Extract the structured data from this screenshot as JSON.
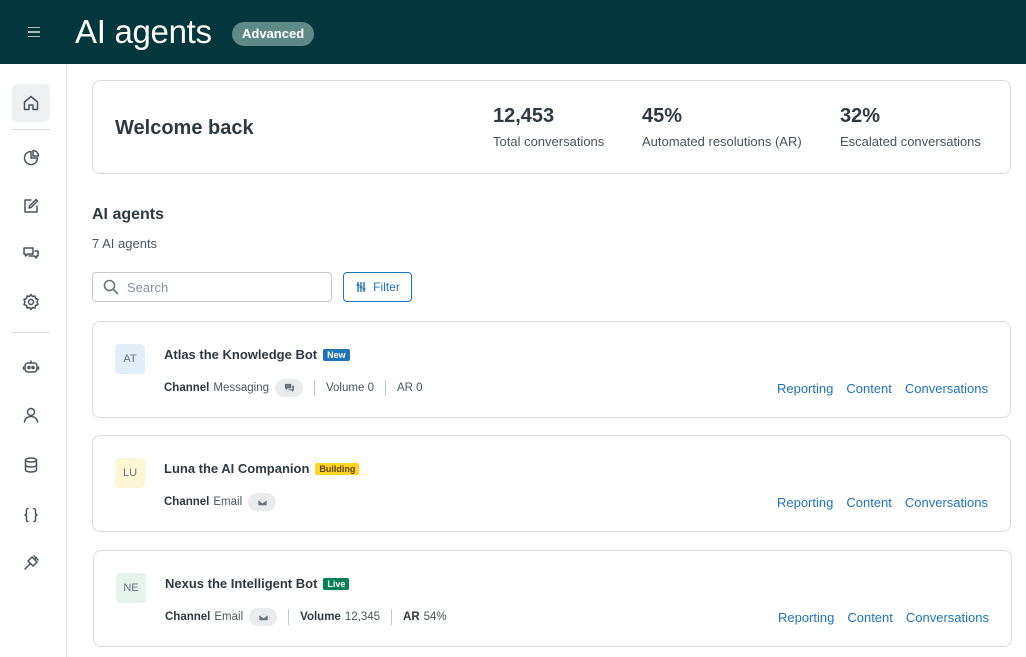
{
  "header": {
    "title": "AI agents",
    "plan_badge": "Advanced"
  },
  "sidebar": {
    "items": [
      {
        "name": "home-icon",
        "active": true
      },
      {
        "name": "analytics-icon"
      },
      {
        "name": "edit-icon"
      },
      {
        "name": "conversations-icon"
      },
      {
        "name": "settings-icon"
      },
      {
        "name": "bot-icon"
      },
      {
        "name": "user-icon"
      },
      {
        "name": "database-icon"
      },
      {
        "name": "code-icon"
      },
      {
        "name": "integrations-icon"
      }
    ]
  },
  "welcome": {
    "title": "Welcome back",
    "stats": [
      {
        "value": "12,453",
        "label": "Total conversations"
      },
      {
        "value": "45%",
        "label": "Automated resolutions (AR)"
      },
      {
        "value": "32%",
        "label": "Escalated conversations"
      }
    ]
  },
  "agents_section": {
    "title": "AI agents",
    "count": "7 AI agents",
    "search_placeholder": "Search",
    "filter_label": "Filter"
  },
  "agents": [
    {
      "initials": "AT",
      "name": "Atlas the Knowledge Bot",
      "status": "New",
      "status_bg": "#1f73b7",
      "status_fg": "#ffffff",
      "avatar_bg": "#e1effa",
      "channel_label": "Channel",
      "channel": "Messaging",
      "channel_icon": "chat-icon",
      "volume_label": "Volume",
      "volume": "0",
      "ar_label": "AR",
      "ar": "0"
    },
    {
      "initials": "LU",
      "name": "Luna the AI Companion",
      "status": "Building",
      "status_bg": "#ffd424",
      "status_fg": "#5a4200",
      "avatar_bg": "#fff6d6",
      "channel_label": "Channel",
      "channel": "Email",
      "channel_icon": "mail-icon"
    },
    {
      "initials": "NE",
      "name": "Nexus the Intelligent Bot",
      "status": "Live",
      "status_bg": "#038153",
      "status_fg": "#ffffff",
      "avatar_bg": "#e6f4ee",
      "channel_label": "Channel",
      "channel": "Email",
      "channel_icon": "mail-icon",
      "volume_label": "Volume",
      "volume": "12,345",
      "ar_label": "AR",
      "ar": "54%"
    }
  ],
  "agent_links": {
    "reporting": "Reporting",
    "content": "Content",
    "conversations": "Conversations"
  }
}
